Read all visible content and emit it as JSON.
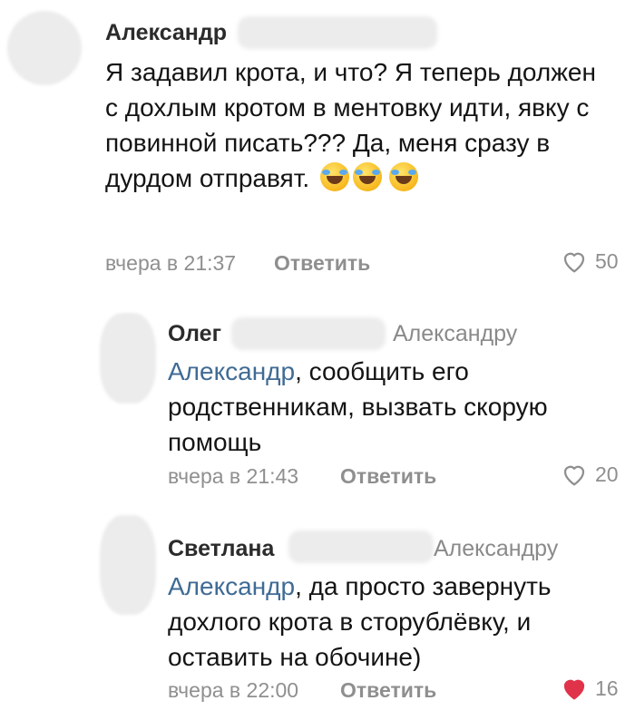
{
  "comments": [
    {
      "author": "Александр",
      "reply_to_prefix": "",
      "mention": "",
      "text": "Я задавил крота, и что? Я теперь должен с дохлым кротом в ментовку идти, явку с повинной писать??? Да, меня сразу в дурдом отправят.",
      "emoji_name": "rolling-on-the-floor-laughing-icon",
      "time": "вчера в 21:37",
      "reply_label": "Ответить",
      "likes": "50",
      "liked": false
    },
    {
      "author": "Олег",
      "reply_to": "Александру",
      "mention": "Александр",
      "text": ", сообщить его родственникам, вызвать скорую помощь",
      "time": "вчера в 21:43",
      "reply_label": "Ответить",
      "likes": "20",
      "liked": false
    },
    {
      "author": "Светлана",
      "reply_to": "Александру",
      "mention": "Александр",
      "text": ", да просто завернуть дохлого крота в сторублёвку, и оставить на обочине)",
      "time": "вчера в 22:00",
      "reply_label": "Ответить",
      "likes": "16",
      "liked": true
    }
  ],
  "colors": {
    "mention": "#3f6b95",
    "meta": "#8f8f8f",
    "liked_heart": "#e0334a"
  }
}
